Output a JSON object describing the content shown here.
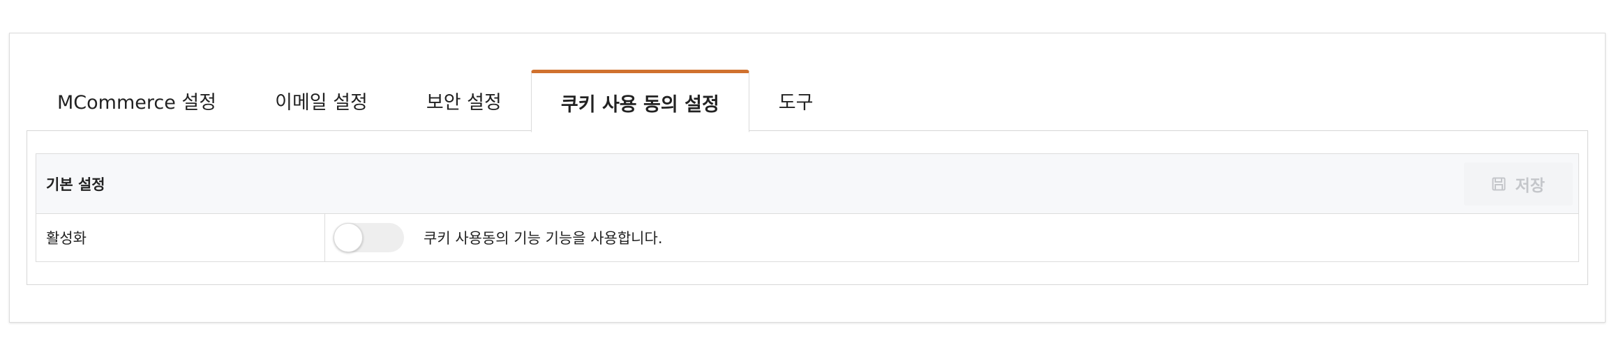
{
  "tabs": [
    {
      "label": "MCommerce 설정",
      "active": false
    },
    {
      "label": "이메일 설정",
      "active": false
    },
    {
      "label": "보안 설정",
      "active": false
    },
    {
      "label": "쿠키 사용 동의 설정",
      "active": true
    },
    {
      "label": "도구",
      "active": false
    }
  ],
  "section": {
    "title": "기본 설정",
    "save_label": "저장",
    "save_icon": "floppy-disk-icon"
  },
  "rows": [
    {
      "label": "활성화",
      "toggle_on": false,
      "description": "쿠키 사용동의 기능 기능을 사용합니다."
    }
  ],
  "colors": {
    "active_tab_accent": "#d0712e",
    "header_bg": "#f7f8fa",
    "disabled_text": "#c4c6ca"
  }
}
